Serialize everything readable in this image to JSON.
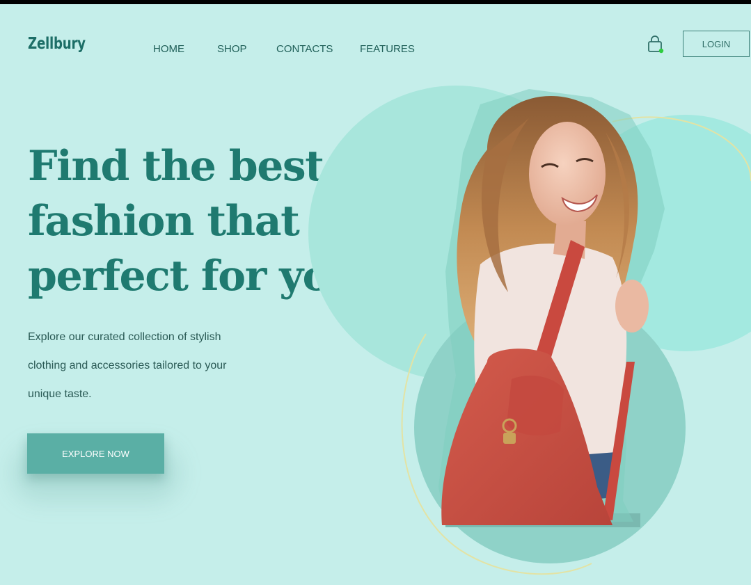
{
  "brand": {
    "name": "Zellbury"
  },
  "nav": {
    "items": [
      "HOME",
      "SHOP",
      "CONTACTS",
      "FEATURES"
    ]
  },
  "header": {
    "cart_icon": "shopping-bag-icon",
    "login_label": "LOGIN"
  },
  "hero": {
    "headline": [
      "Find the best",
      "fashion that is",
      "perfect for you!"
    ],
    "subtext": [
      "Explore our curated collection of stylish",
      "clothing and accessories tailored to your",
      "unique taste."
    ],
    "cta_label": "EXPLORE NOW",
    "image": "woman-with-red-backpack"
  },
  "colors": {
    "background": "#c5eeea",
    "brand": "#1d6e67",
    "headline": "#1f7a70",
    "button": "#5aafa5",
    "circle_light": "#a8e6dc",
    "circle_dark": "#8fd2c8",
    "cart_dot": "#2ecc40"
  }
}
